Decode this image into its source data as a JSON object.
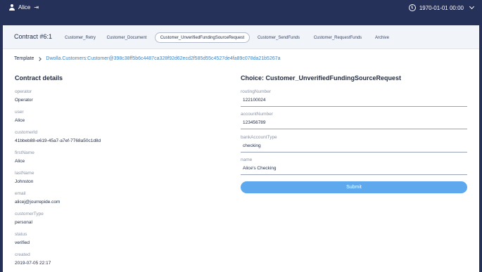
{
  "topbar": {
    "user_name": "Alice",
    "datetime": "1970-01-01 00:00"
  },
  "contract": {
    "title": "Contract #6:1",
    "tabs": [
      {
        "label": "Customer_Retry",
        "active": false
      },
      {
        "label": "Customer_Document",
        "active": false
      },
      {
        "label": "Customer_UnverifiedFundingSourceRequest",
        "active": true
      },
      {
        "label": "Customer_SendFunds",
        "active": false
      },
      {
        "label": "Customer_RequestFunds",
        "active": false
      },
      {
        "label": "Archive",
        "active": false
      }
    ]
  },
  "breadcrumb": {
    "template_label": "Template",
    "template_id": "Dwolla.Customers:Customer@398c38ff5b6c4487ca328f92d62ecd2f585d55c4527de4fa89c078da21b5267a"
  },
  "details": {
    "title": "Contract details",
    "fields": [
      {
        "label": "operator",
        "value": "Operator"
      },
      {
        "label": "user",
        "value": "Alice"
      },
      {
        "label": "customerId",
        "value": "41bbeb88-e619-45a7-a7ef-7768a50c1d8d"
      },
      {
        "label": "firstName",
        "value": "Alice"
      },
      {
        "label": "lastName",
        "value": "Johnston"
      },
      {
        "label": "email",
        "value": "alicej@jourrepide.com"
      },
      {
        "label": "customerType",
        "value": "personal"
      },
      {
        "label": "status",
        "value": "verified"
      },
      {
        "label": "created",
        "value": "2019-07-05 22:17"
      }
    ]
  },
  "choice": {
    "title": "Choice: Customer_UnverifiedFundingSourceRequest",
    "inputs": [
      {
        "label": "routingNumber",
        "value": "122100024"
      },
      {
        "label": "accountNumber",
        "value": "123456789"
      },
      {
        "label": "bankAccountType",
        "value": "checking"
      },
      {
        "label": "name",
        "value": "Alice's Checking"
      }
    ],
    "submit_label": "Submit"
  },
  "colors": {
    "background": "#263159",
    "accent": "#5ea8ee",
    "link": "#3b82c4"
  }
}
